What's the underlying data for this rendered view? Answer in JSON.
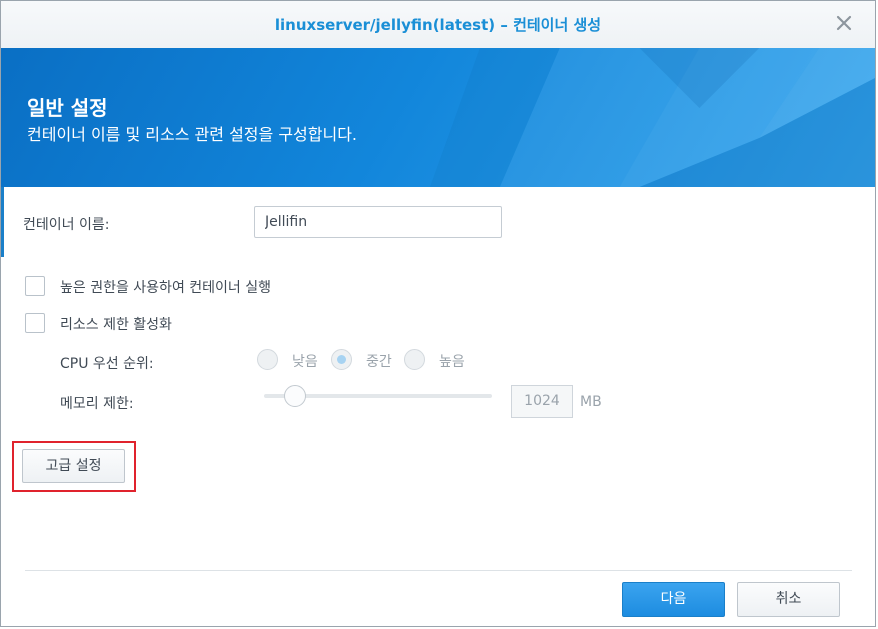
{
  "window": {
    "title": "linuxserver/jellyfin(latest) – 컨테이너 생성"
  },
  "banner": {
    "title": "일반 설정",
    "subtitle": "컨테이너 이름 및 리소스 관련 설정을 구성합니다."
  },
  "form": {
    "container_name_label": "컨테이너 이름:",
    "container_name_value": "Jellifin",
    "privileged_label": "높은 권한을 사용하여 컨테이너 실행",
    "privileged_checked": false,
    "resource_limit_label": "리소스 제한 활성화",
    "resource_limit_checked": false,
    "cpu_priority_label": "CPU 우선 순위:",
    "cpu_options": [
      "낮음",
      "중간",
      "높음"
    ],
    "cpu_selected": "중간",
    "memory_limit_label": "메모리 제한:",
    "memory_value": "1024",
    "memory_unit": "MB",
    "memory_slider_fraction": 0.12
  },
  "buttons": {
    "advanced": "고급 설정",
    "next": "다음",
    "cancel": "취소"
  },
  "colors": {
    "accent": "#1a8fd6",
    "banner": "#1286db",
    "highlight": "#e0232d"
  }
}
